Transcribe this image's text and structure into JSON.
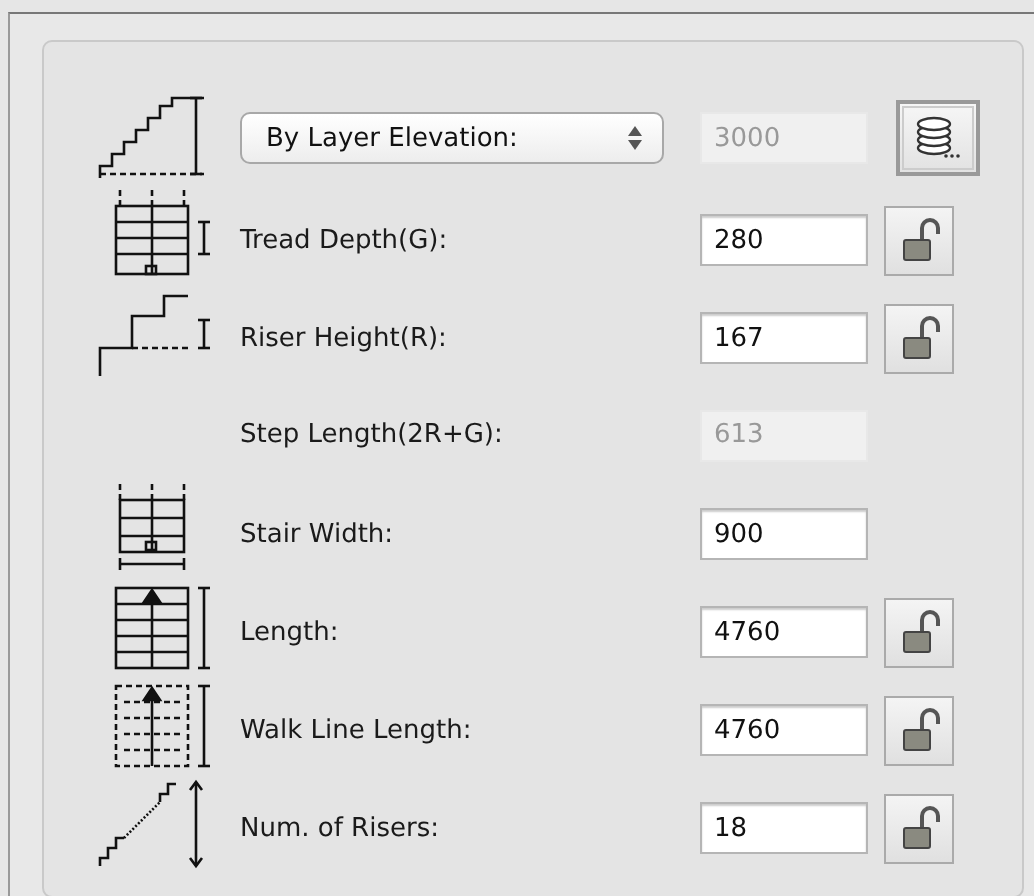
{
  "elevation": {
    "dropdown": "By Layer Elevation:",
    "value": "3000",
    "disabled": true
  },
  "rows": [
    {
      "label": "Tread Depth(G):",
      "value": "280",
      "disabled": false,
      "lock": true,
      "locked": false
    },
    {
      "label": "Riser Height(R):",
      "value": "167",
      "disabled": false,
      "lock": true,
      "locked": false
    },
    {
      "label": "Step Length(2R+G):",
      "value": "613",
      "disabled": true,
      "lock": false
    },
    {
      "label": "Stair Width:",
      "value": "900",
      "disabled": false,
      "lock": false
    },
    {
      "label": "Length:",
      "value": "4760",
      "disabled": false,
      "lock": true,
      "locked": false
    },
    {
      "label": "Walk Line Length:",
      "value": "4760",
      "disabled": false,
      "lock": true,
      "locked": false
    },
    {
      "label": "Num. of Risers:",
      "value": "18",
      "disabled": false,
      "lock": true,
      "locked": false
    }
  ]
}
